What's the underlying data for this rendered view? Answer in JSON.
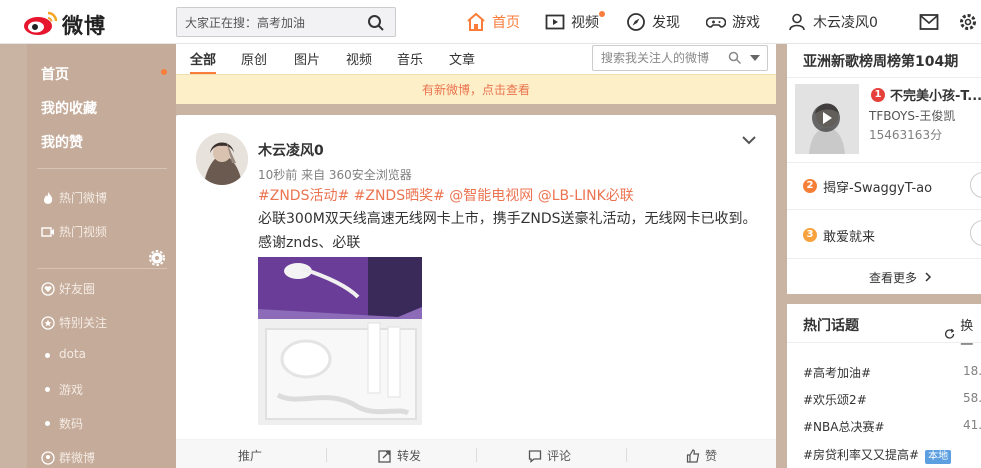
{
  "header": {
    "logo_text": "微博",
    "search_placeholder": "大家正在搜：高考加油",
    "nav": [
      {
        "label": "首页",
        "icon": "home-icon"
      },
      {
        "label": "视频",
        "icon": "video-icon"
      },
      {
        "label": "发现",
        "icon": "compass-icon"
      },
      {
        "label": "游戏",
        "icon": "gamepad-icon"
      },
      {
        "label": "木云凌风0",
        "icon": "user-icon"
      }
    ],
    "accent": "#fa7d3c"
  },
  "sidebar": {
    "primary": [
      "首页",
      "我的收藏",
      "我的赞"
    ],
    "secondary": [
      {
        "label": "热门微博",
        "icon": "fire-icon"
      },
      {
        "label": "热门视频",
        "icon": "video-icon"
      }
    ],
    "groups": [
      {
        "label": "好友圈",
        "icon": "heart-icon"
      },
      {
        "label": "特别关注",
        "icon": "star-icon"
      }
    ],
    "bullets": [
      "dota",
      "游戏",
      "数码",
      "群微博"
    ]
  },
  "feed_tabs": {
    "tabs": [
      "全部",
      "原创",
      "图片",
      "视频",
      "音乐",
      "文章"
    ],
    "filter_placeholder": "搜索我关注人的微博",
    "new_notice": "有新微博，点击查看"
  },
  "post": {
    "username": "木云凌风0",
    "meta": "10秒前 来自 360安全浏览器",
    "tags": "#ZNDS活动# #ZNDS晒奖# @智能电视网 @LB-LINK必联",
    "text_line1": "必联300M双天线高速无线网卡上市，携手ZNDS送豪礼活动，无线网卡已收到。",
    "text_line2": "感谢znds、必联",
    "actions": [
      "推广",
      "转发",
      "评论",
      "赞"
    ]
  },
  "music_chart": {
    "title": "亚洲新歌榜周榜第104期",
    "top": {
      "rank": "1",
      "song": "不完美小孩-T...",
      "artist": "TFBOYS-王俊凯",
      "score": "15463163分"
    },
    "others": [
      {
        "rank": "2",
        "song": "揭穿-SwaggyT-ao"
      },
      {
        "rank": "3",
        "song": "敢爱就来"
      }
    ],
    "more": "查看更多"
  },
  "hot_topics": {
    "title": "热门话题",
    "refresh": "换一",
    "items": [
      {
        "name": "#高考加油#",
        "count": "18."
      },
      {
        "name": "#欢乐颂2#",
        "count": "58."
      },
      {
        "name": "#NBA总决赛#",
        "count": "41."
      },
      {
        "name": "#房贷利率又又提高#",
        "count": "",
        "badge": "本地"
      }
    ]
  }
}
